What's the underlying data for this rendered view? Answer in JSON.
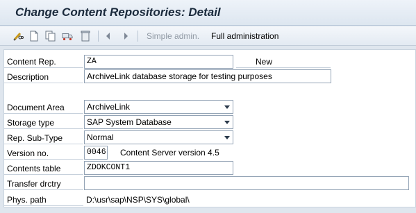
{
  "window": {
    "title": "Change Content Repositories: Detail"
  },
  "toolbar": {
    "icons": [
      "pencil-glasses-icon",
      "new-page-icon",
      "copy-icon",
      "transport-icon",
      "trash-icon",
      "previous-icon",
      "next-icon"
    ],
    "simple_admin_label": "Simple admin.",
    "full_admin_label": "Full administration"
  },
  "form": {
    "content_rep": {
      "label": "Content Rep.",
      "value": "ZA",
      "status": "New"
    },
    "description": {
      "label": "Description",
      "value": "ArchiveLink database storage for testing purposes"
    },
    "document_area": {
      "label": "Document Area",
      "value": "ArchiveLink"
    },
    "storage_type": {
      "label": "Storage type",
      "value": "SAP System Database"
    },
    "rep_sub_type": {
      "label": "Rep. Sub-Type",
      "value": "Normal"
    },
    "version_no": {
      "label": "Version no.",
      "value": "0046",
      "note": "Content Server version 4.5"
    },
    "contents_table": {
      "label": "Contents table",
      "value": "ZDOKCONT1"
    },
    "transfer_drctry": {
      "label": "Transfer drctry",
      "value": ""
    },
    "phys_path": {
      "label": "Phys. path",
      "value": "D:\\usr\\sap\\NSP\\SYS\\global\\"
    }
  }
}
